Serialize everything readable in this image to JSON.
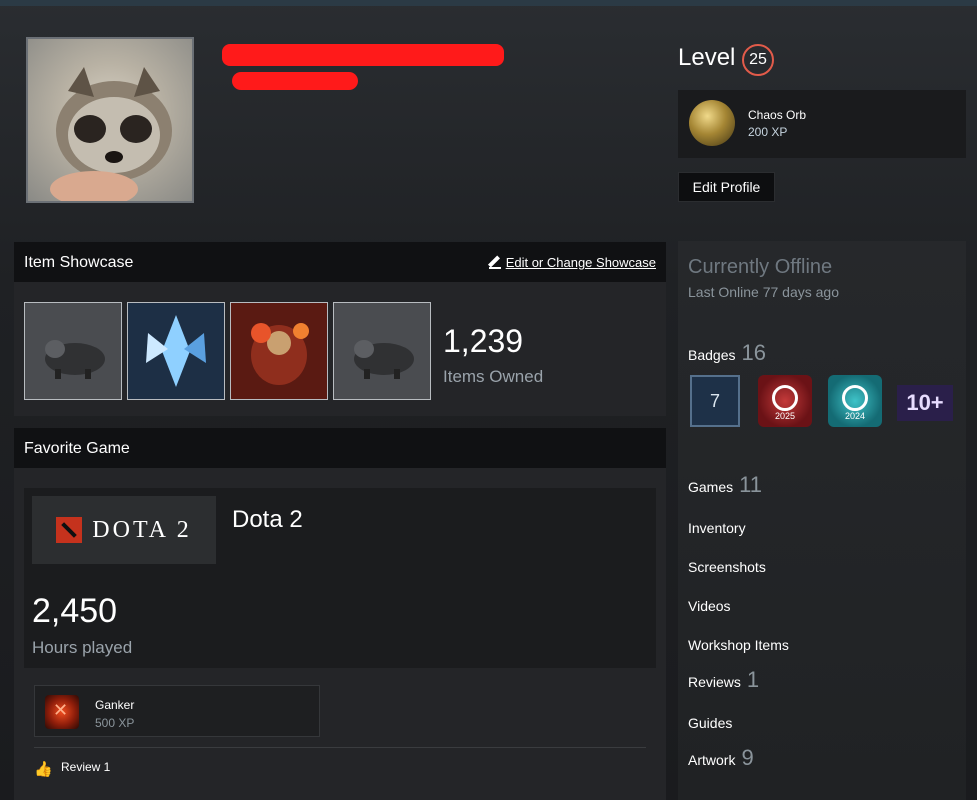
{
  "profile": {
    "level_label": "Level",
    "level": "25",
    "favorite_badge": {
      "name": "Chaos Orb",
      "xp": "200 XP"
    },
    "edit_profile_label": "Edit Profile"
  },
  "item_showcase": {
    "title": "Item Showcase",
    "edit_link": "Edit or Change Showcase",
    "items_owned_count": "1,239",
    "items_owned_label": "Items Owned"
  },
  "favorite_game": {
    "title": "Favorite Game",
    "logo_text": "DOTA 2",
    "game_name": "Dota 2",
    "hours": "2,450",
    "hours_label": "Hours played",
    "achievement": {
      "name": "Ganker",
      "xp": "500 XP"
    },
    "review_label": "Review 1"
  },
  "status": {
    "state": "Currently Offline",
    "last_online": "Last Online 77 days ago"
  },
  "stats": {
    "badges_label": "Badges",
    "badges_count": "16",
    "games_label": "Games",
    "games_count": "11",
    "inventory_label": "Inventory",
    "screenshots_label": "Screenshots",
    "videos_label": "Videos",
    "workshop_label": "Workshop Items",
    "reviews_label": "Reviews",
    "reviews_count": "1",
    "guides_label": "Guides",
    "artwork_label": "Artwork",
    "artwork_count": "9"
  },
  "badge_icons": [
    {
      "icon": "years-of-service-icon",
      "text": "7"
    },
    {
      "icon": "steam-2025-badge-icon",
      "text": "2025"
    },
    {
      "icon": "steam-2024-badge-icon",
      "text": "2024"
    },
    {
      "icon": "game-collector-badge-icon",
      "text": "10+"
    }
  ]
}
